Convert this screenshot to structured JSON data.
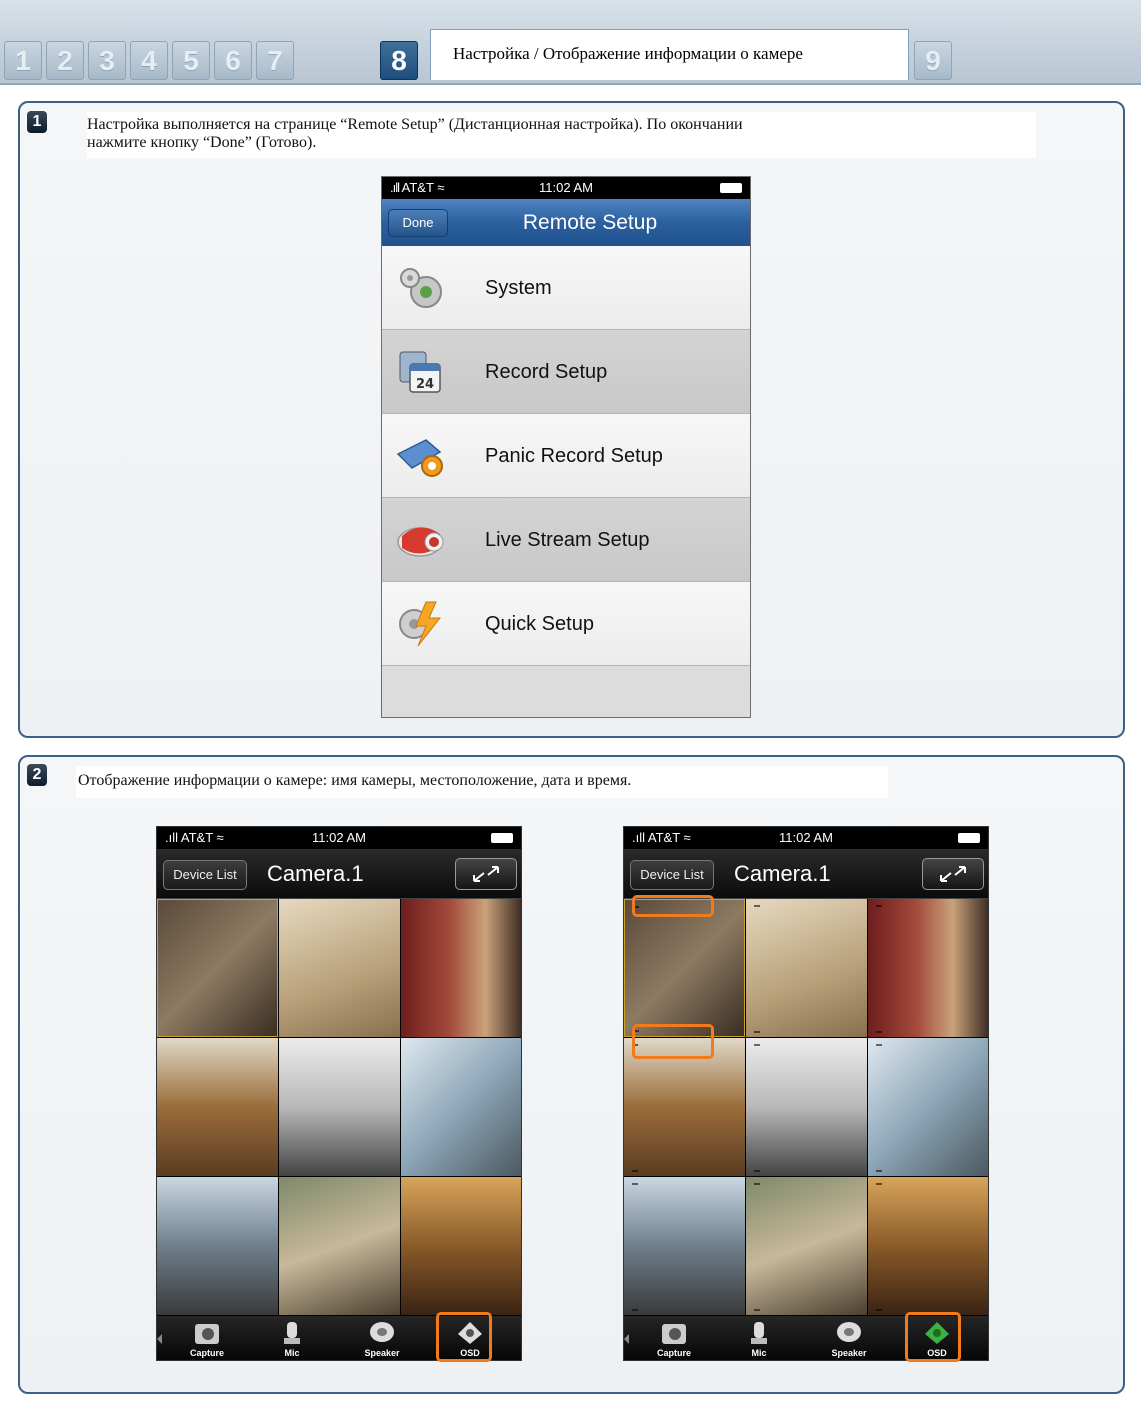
{
  "tabbar": {
    "tabs": [
      "1",
      "2",
      "3",
      "4",
      "5",
      "6",
      "7",
      "8",
      "9"
    ],
    "active_tab": "8",
    "section_title": "Настройка / Отображение информации о камере"
  },
  "step1": {
    "number": "1",
    "caption_line1": "Настройка выполняется на странице “Remote Setup” (Дистанционная настройка). По окончании",
    "caption_line2": "нажмите кнопку “Done” (Готово).",
    "phone": {
      "carrier": "AT&T",
      "time": "11:02 AM",
      "done_label": "Done",
      "title": "Remote Setup",
      "items": [
        {
          "label": "System",
          "icon": "gears-icon"
        },
        {
          "label": "Record Setup",
          "icon": "calendar-icon"
        },
        {
          "label": "Panic Record Setup",
          "icon": "panic-record-icon"
        },
        {
          "label": "Live Stream Setup",
          "icon": "camera-icon"
        },
        {
          "label": "Quick Setup",
          "icon": "lightning-gear-icon"
        }
      ]
    }
  },
  "step2": {
    "number": "2",
    "caption": "Отображение информации о камере: имя камеры, местоположение, дата и время.",
    "phone_left": {
      "carrier": "AT&T",
      "time": "11:02 AM",
      "back_label": "Device List",
      "title": "Camera.1",
      "toolbar": [
        "Capture",
        "Mic",
        "Speaker",
        "OSD"
      ]
    },
    "phone_right": {
      "carrier": "AT&T",
      "time": "11:02 AM",
      "back_label": "Device List",
      "title": "Camera.1",
      "toolbar": [
        "Capture",
        "Mic",
        "Speaker",
        "OSD"
      ]
    }
  },
  "colors": {
    "panel_border": "#3e5f86",
    "tab_active": "#1e4e7c",
    "highlight": "#f07a1c",
    "ios_nav": "#2b5f9e"
  }
}
